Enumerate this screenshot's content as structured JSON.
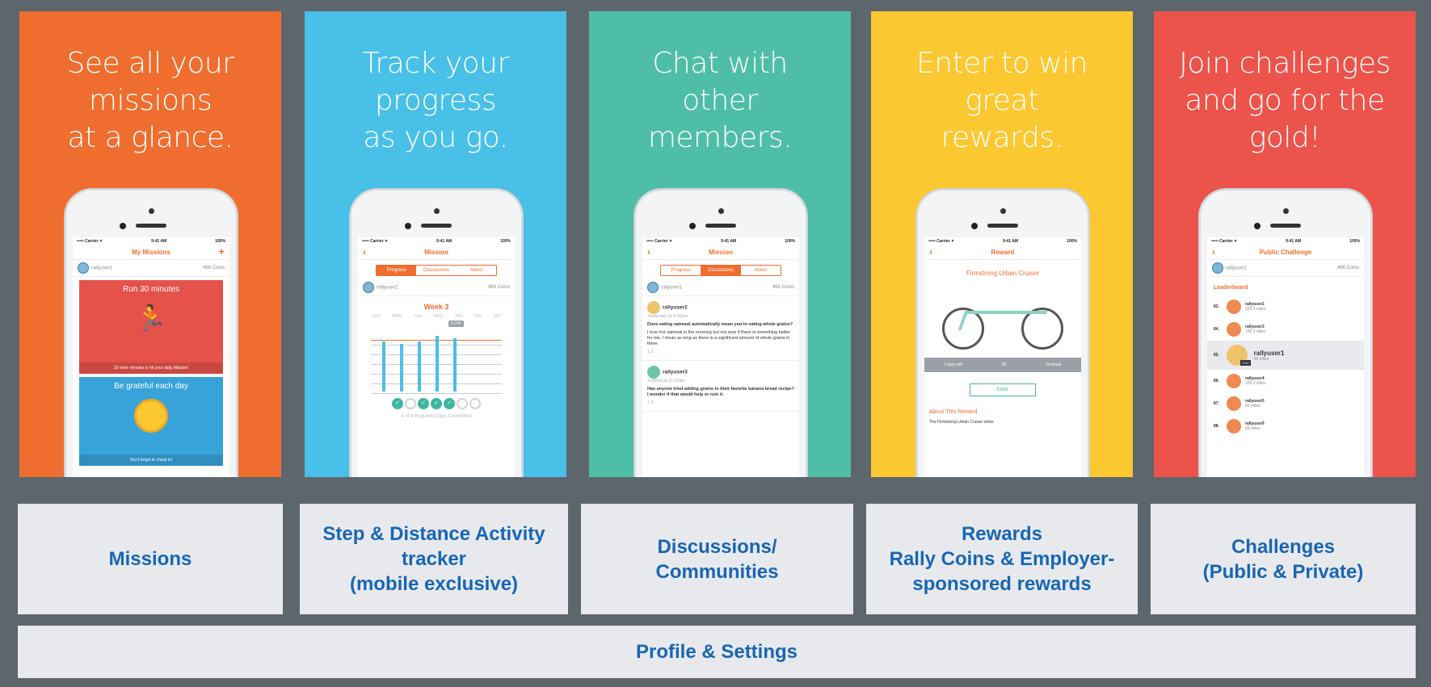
{
  "panels": [
    {
      "title": "See all your\nmissions\nat a glance.",
      "color": "#ef6d2e",
      "phone": {
        "status": {
          "carrier": "••••• Carrier ✦",
          "time": "9:41 AM",
          "battery": "100%"
        },
        "nav_title": "My Missions",
        "user": {
          "name": "rallyuser1",
          "coins": "466 Coins"
        },
        "cards": [
          {
            "title": "Run 30 minutes",
            "footer": "30 more minutes to hit your daily Mission!"
          },
          {
            "title": "Be grateful each day",
            "footer": "Don't forget to check in!"
          }
        ]
      }
    },
    {
      "title": "Track your\nprogress\nas you go.",
      "color": "#48c0e8",
      "phone": {
        "status": {
          "carrier": "••••• Carrier ✦",
          "time": "9:41 AM",
          "battery": "100%"
        },
        "nav_title": "Mission",
        "tabs": [
          "Progress",
          "Discussions",
          "About"
        ],
        "active_tab": 0,
        "user": {
          "name": "rallyuser1",
          "coins": "466 Coins"
        },
        "week_label": "Week 3",
        "days": [
          "SUN",
          "MON",
          "TUE",
          "WED",
          "THU",
          "FRI",
          "SAT"
        ],
        "bar_label": "8,246",
        "bars": [
          0.78,
          0.74,
          0.78,
          0.86,
          0.82
        ],
        "checks": [
          true,
          false,
          true,
          true,
          true,
          false,
          false
        ],
        "note": "4 of 4 Required Days Completed"
      }
    },
    {
      "title": "Chat with\nother\nmembers.",
      "color": "#4fbea8",
      "phone": {
        "status": {
          "carrier": "••••• Carrier ✦",
          "time": "9:41 AM",
          "battery": "100%"
        },
        "nav_title": "Mission",
        "tabs": [
          "Progress",
          "Discussions",
          "About"
        ],
        "active_tab": 1,
        "user": {
          "name": "rallyuser1",
          "coins": "466 Coins"
        },
        "posts": [
          {
            "author": "rallyuser2",
            "time": "Yesterday at 4:03pm",
            "question": "Does eating oatmeal automatically mean you're eating whole grains?",
            "body": "I love hot oatmeal in the morning but not sure if there is something better for me. I mean as long as there is a significant amount of whole grains in there.",
            "counts": "1   2"
          },
          {
            "author": "rallyuser3",
            "time": "2/28/16 at 11:23am",
            "question": "Has anyone tried adding grains to their favorite banana bread recipe? I wonder if that would help or ruin it.",
            "body": "",
            "counts": "1   3"
          }
        ],
        "fab": "+"
      }
    },
    {
      "title": "Enter to win\ngreat\nrewards.",
      "color": "#fcc831",
      "phone": {
        "status": {
          "carrier": "••••• Carrier ✦",
          "time": "9:41 AM",
          "battery": "100%"
        },
        "nav_title": "Reward",
        "reward_title": "Firmstrong Urban Cruiser",
        "stats": [
          "3 days left",
          "50",
          "Continue"
        ],
        "enter_label": "Enter",
        "about_title": "About This Reward",
        "about_text": "The Firmstrong Urban Cruiser strike"
      }
    },
    {
      "title": "Join challenges\nand go for the\ngold!",
      "color": "#ec534a",
      "phone": {
        "status": {
          "carrier": "••••• Carrier ✦",
          "time": "9:41 AM",
          "battery": "100%"
        },
        "nav_title": "Public Challenge",
        "user": {
          "name": "rallyuser1",
          "coins": "466 Coins"
        },
        "leaderboard_label": "Leaderboard",
        "rows": [
          {
            "rank": "83.",
            "name": "rallyuser2",
            "miles": "200.1 miles"
          },
          {
            "rank": "84.",
            "name": "rallyuser3",
            "miles": "155.2 miles"
          },
          {
            "rank": "85.",
            "name": "rallyuser1",
            "miles": "55 miles",
            "me": true,
            "badge": "YOU"
          },
          {
            "rank": "86.",
            "name": "rallyuser4",
            "miles": "155.2 miles"
          },
          {
            "rank": "87.",
            "name": "rallyuser5",
            "miles": "55 miles"
          },
          {
            "rank": "88.",
            "name": "rallyuser6",
            "miles": "55 miles"
          }
        ]
      }
    }
  ],
  "features": [
    "Missions",
    "Step & Distance Activity\ntracker\n(mobile exclusive)",
    "Discussions/\nCommunities",
    "Rewards\nRally Coins & Employer-\nsponsored rewards",
    "Challenges\n(Public & Private)"
  ],
  "profile_label": "Profile & Settings"
}
